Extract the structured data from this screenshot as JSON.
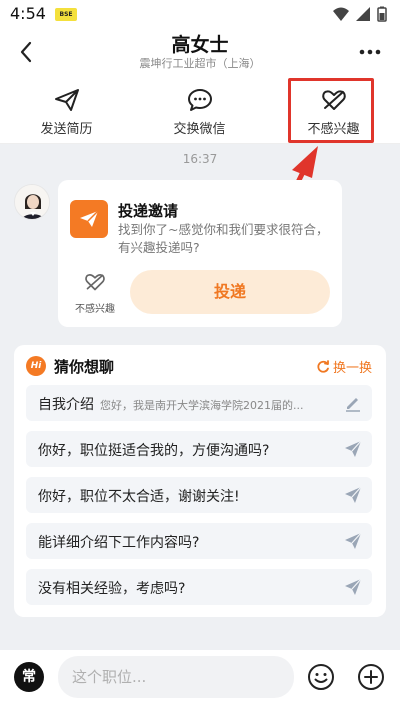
{
  "status": {
    "time": "4:54",
    "badge": "BSE"
  },
  "header": {
    "title": "高女士",
    "subtitle": "震坤行工业超市（上海）"
  },
  "actions": [
    {
      "label": "发送简历",
      "icon": "paper-plane-icon"
    },
    {
      "label": "交换微信",
      "icon": "chat-bubble-icon"
    },
    {
      "label": "不感兴趣",
      "icon": "broken-heart-icon"
    }
  ],
  "chat": {
    "timestamp": "16:37",
    "invite": {
      "title": "投递邀请",
      "description": "找到你了~感觉你和我们要求很符合，有兴趣投递吗?",
      "uninterested_label": "不感兴趣",
      "deliver_label": "投递"
    }
  },
  "guess": {
    "title": "猜你想聊",
    "refresh_label": "换一换",
    "items": [
      {
        "text": "自我介绍",
        "sub": "您好，我是南开大学滨海学院2021届的...",
        "icon": "edit-icon"
      },
      {
        "text": "你好，职位挺适合我的，方便沟通吗?",
        "sub": "",
        "icon": "send-icon"
      },
      {
        "text": "你好，职位不太合适，谢谢关注!",
        "sub": "",
        "icon": "send-icon"
      },
      {
        "text": "能详细介绍下工作内容吗?",
        "sub": "",
        "icon": "send-icon"
      },
      {
        "text": "没有相关经验，考虑吗?",
        "sub": "",
        "icon": "send-icon"
      }
    ]
  },
  "bottom": {
    "quick_label": "常",
    "input_placeholder": "这个职位..."
  },
  "colors": {
    "accent": "#f47a24",
    "highlight": "#e0352b"
  }
}
